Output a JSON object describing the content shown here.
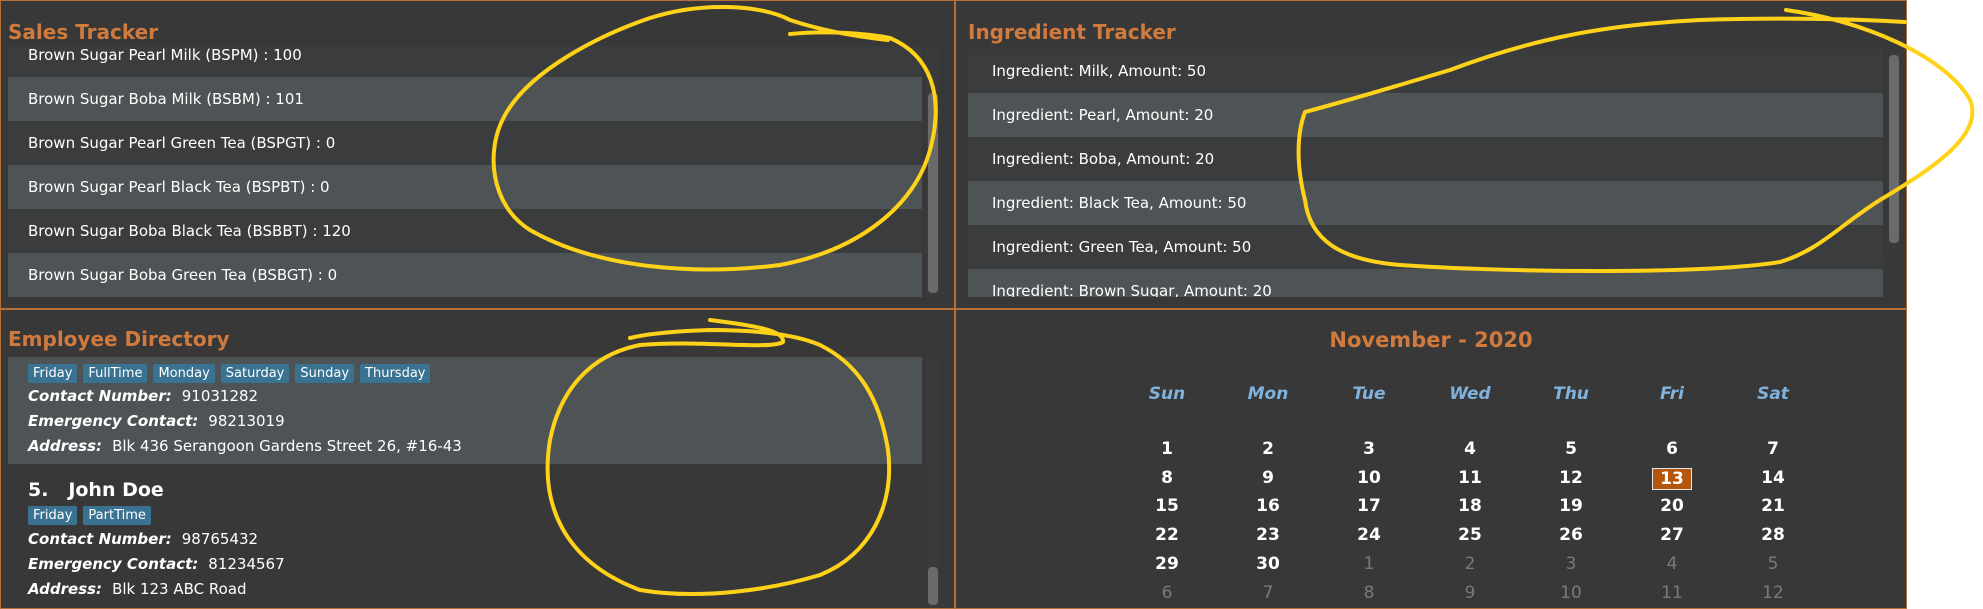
{
  "sales": {
    "title": "Sales Tracker",
    "items": [
      "Brown Sugar Pearl Milk (BSPM) : 100",
      "Brown Sugar Boba Milk (BSBM) : 101",
      "Brown Sugar Pearl Green Tea (BSPGT) : 0",
      "Brown Sugar Pearl Black Tea (BSPBT) : 0",
      "Brown Sugar Boba Black Tea (BSBBT) : 120",
      "Brown Sugar Boba Green Tea (BSBGT) : 0"
    ]
  },
  "ingredients": {
    "title": "Ingredient Tracker",
    "items": [
      "Ingredient: Milk,  Amount: 50",
      "Ingredient: Pearl,  Amount: 20",
      "Ingredient: Boba,  Amount: 20",
      "Ingredient: Black Tea,  Amount: 50",
      "Ingredient: Green Tea,  Amount: 50",
      "Ingredient: Brown Sugar,  Amount: 20"
    ]
  },
  "employees": {
    "title": "Employee Directory",
    "contact_label": "Contact Number:",
    "emergency_label": "Emergency Contact:",
    "address_label": "Address:",
    "list": [
      {
        "tags": [
          "Friday",
          "FullTime",
          "Monday",
          "Saturday",
          "Sunday",
          "Thursday"
        ],
        "contact": "91031282",
        "emergency": "98213019",
        "address": "Blk 436 Serangoon Gardens Street 26, #16-43"
      },
      {
        "index": "5.",
        "name": "John Doe",
        "tags": [
          "Friday",
          "PartTime"
        ],
        "contact": "98765432",
        "emergency": "81234567",
        "address": "Blk 123 ABC Road"
      }
    ]
  },
  "calendar": {
    "title": "November - 2020",
    "weekdays": [
      "Sun",
      "Mon",
      "Tue",
      "Wed",
      "Thu",
      "Fri",
      "Sat"
    ],
    "weeks": [
      [
        "1",
        "2",
        "3",
        "4",
        "5",
        "6",
        "7"
      ],
      [
        "8",
        "9",
        "10",
        "11",
        "12",
        "13",
        "14"
      ],
      [
        "15",
        "16",
        "17",
        "18",
        "19",
        "20",
        "21"
      ],
      [
        "22",
        "23",
        "24",
        "25",
        "26",
        "27",
        "28"
      ],
      [
        "29",
        "30",
        "1",
        "2",
        "3",
        "4",
        "5"
      ],
      [
        "6",
        "7",
        "8",
        "9",
        "10",
        "11",
        "12"
      ]
    ],
    "today": "13"
  },
  "colors": {
    "background": "#383838",
    "accent": "#d07a3d",
    "tag": "#3a7291",
    "weekday": "#7fb2dd",
    "today": "#b5560f",
    "annotation": "#ffd21a"
  }
}
